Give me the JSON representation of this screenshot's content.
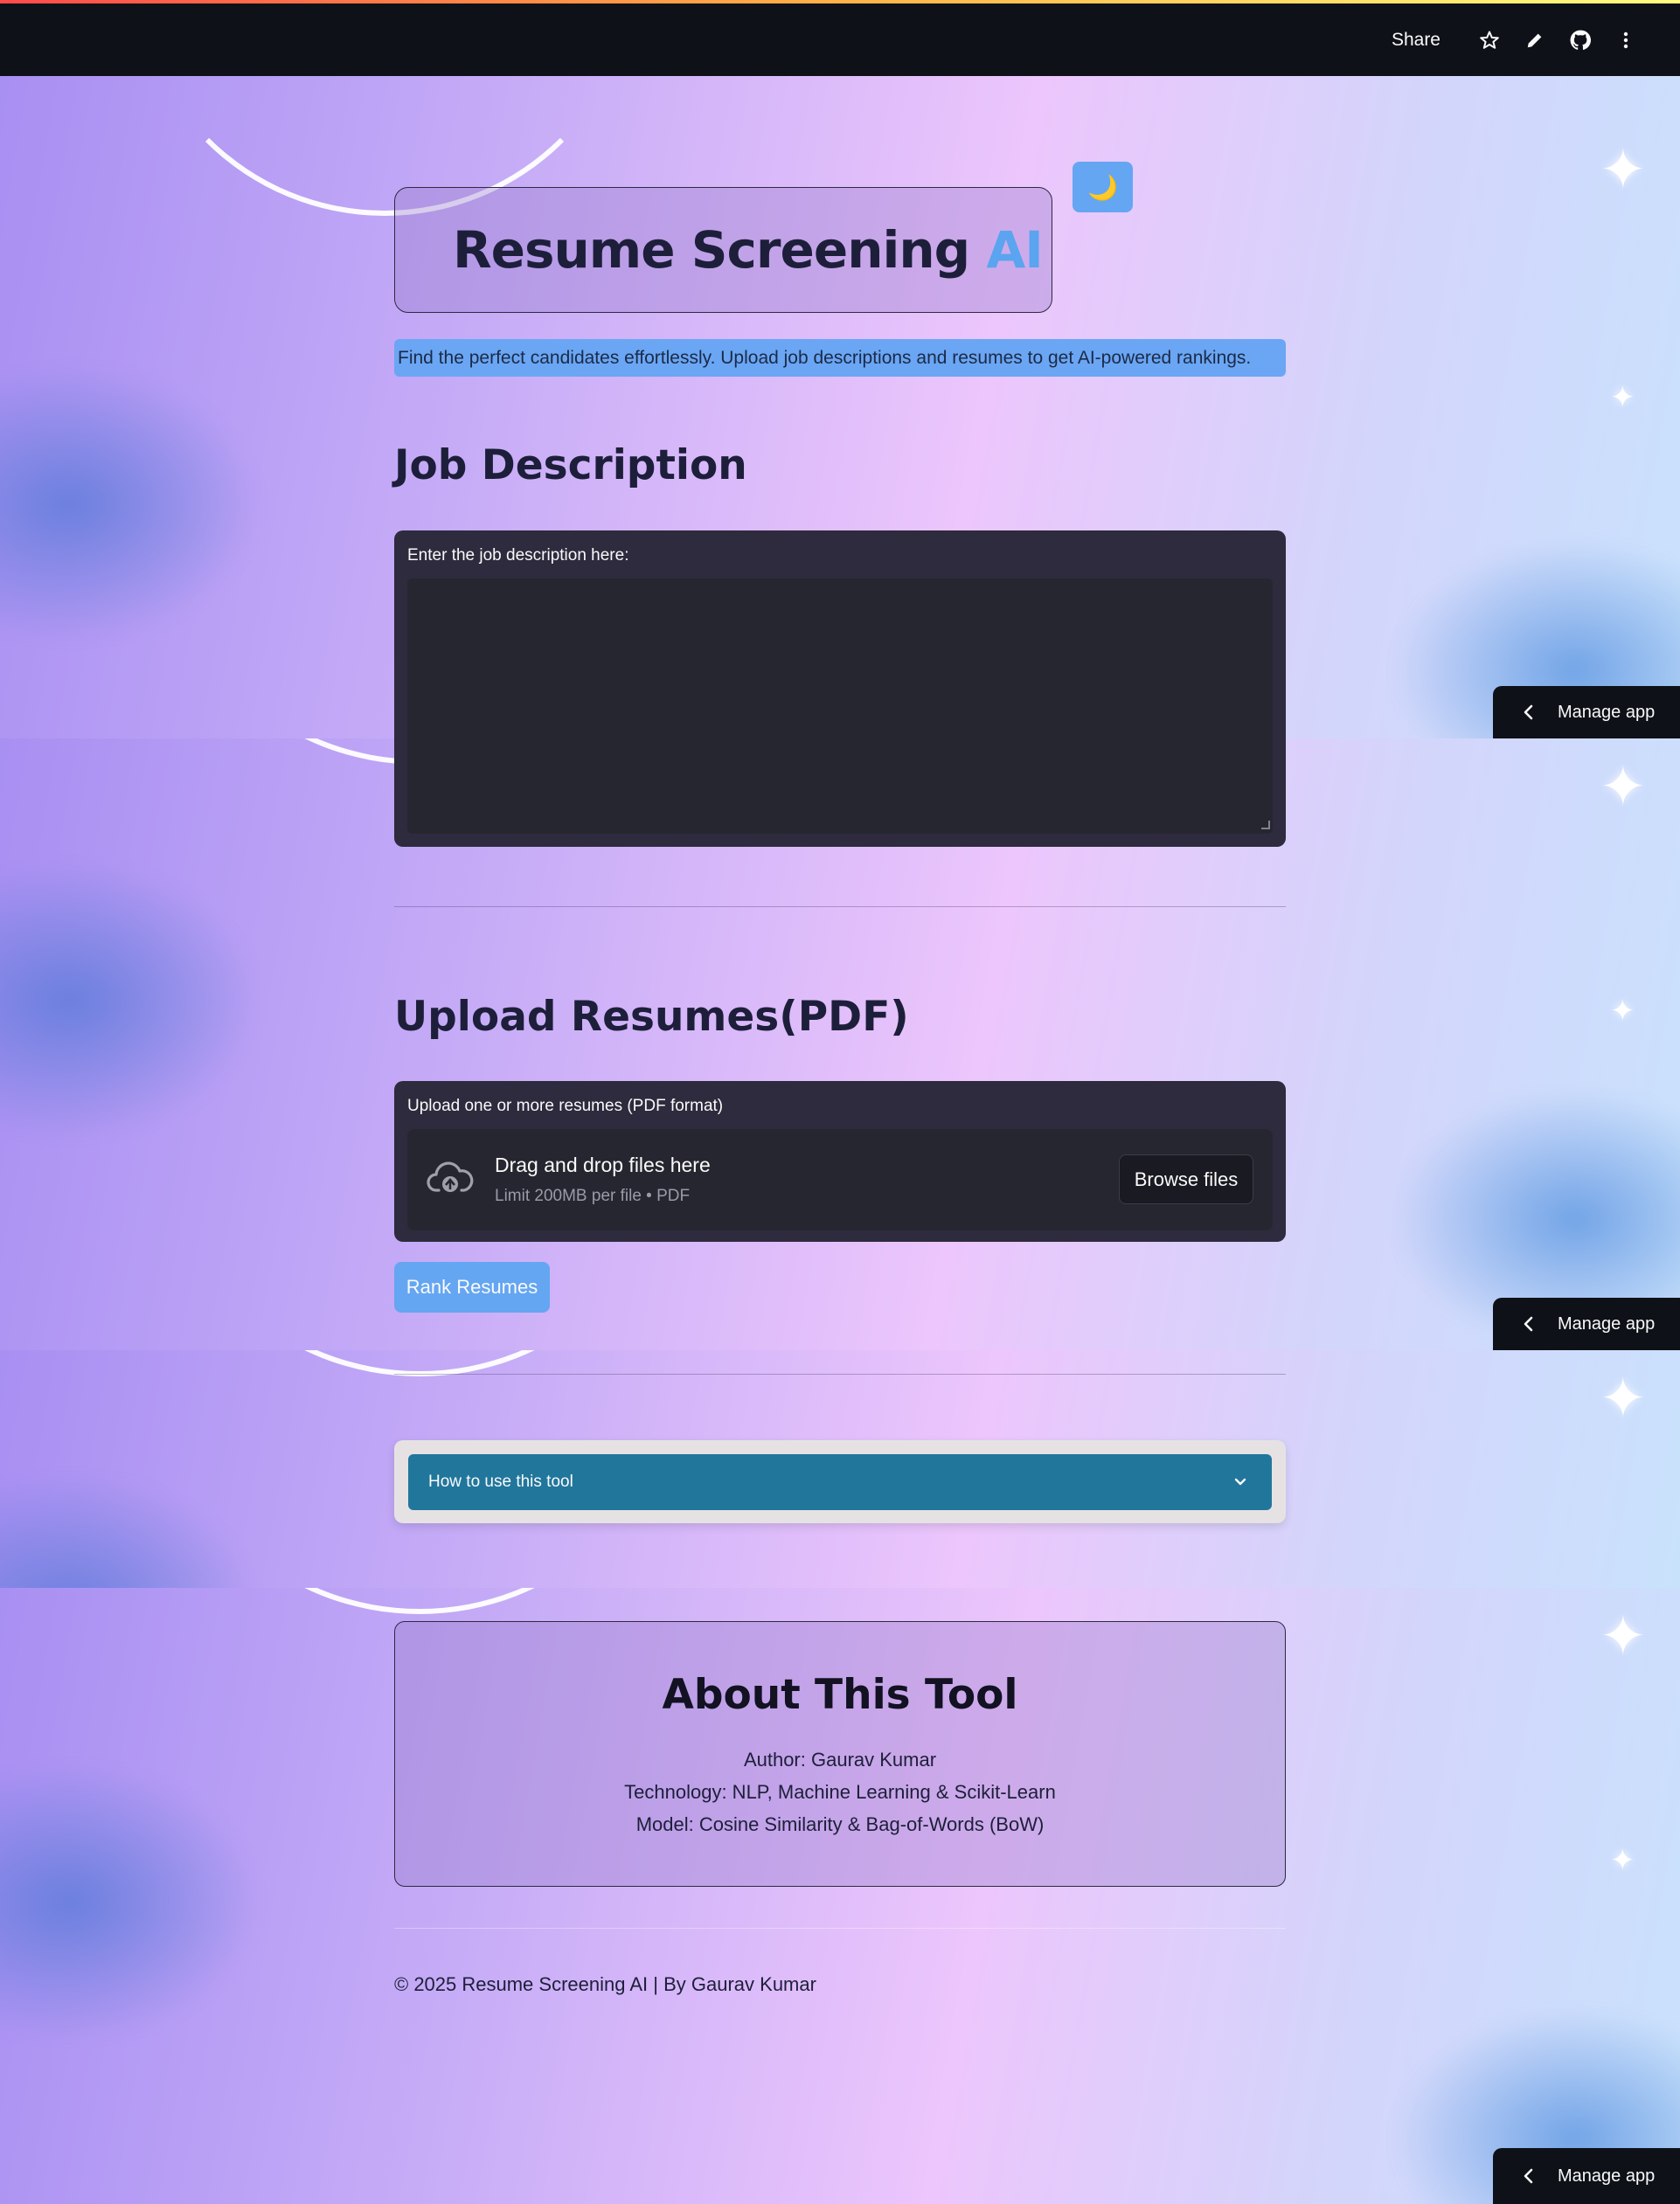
{
  "topbar": {
    "share_label": "Share",
    "icons": [
      "star-icon",
      "pencil-icon",
      "github-icon",
      "more-vertical-icon"
    ]
  },
  "theme_toggle": {
    "glyph": "🌙"
  },
  "header": {
    "title_main": "Resume Screening ",
    "title_accent": "AI",
    "subtitle": "Find the perfect candidates effortlessly. Upload job descriptions and resumes to get AI-powered rankings."
  },
  "job_description": {
    "heading": "Job Description",
    "label": "Enter the job description here:",
    "value": "",
    "placeholder": ""
  },
  "upload": {
    "heading": "Upload Resumes(PDF)",
    "label": "Upload one or more resumes (PDF format)",
    "drop_title": "Drag and drop files here",
    "drop_subtitle": "Limit 200MB per file • PDF",
    "browse_label": "Browse files"
  },
  "rank_button": {
    "label": "Rank Resumes"
  },
  "expander": {
    "label": "How to use this tool"
  },
  "about": {
    "heading": "About This Tool",
    "author": "Author: Gaurav Kumar",
    "technology": "Technology: NLP, Machine Learning & Scikit-Learn",
    "model": "Model: Cosine Similarity & Bag-of-Words (BoW)"
  },
  "footer": {
    "text": "© 2025 Resume Screening AI | By Gaurav Kumar"
  },
  "manage_app": {
    "label": "Manage app"
  },
  "colors": {
    "accent": "#64a6f2",
    "topbar": "#0e1117",
    "panel": "#2d2b3d",
    "expander": "#21769c",
    "title_text": "#1d1f3a"
  }
}
